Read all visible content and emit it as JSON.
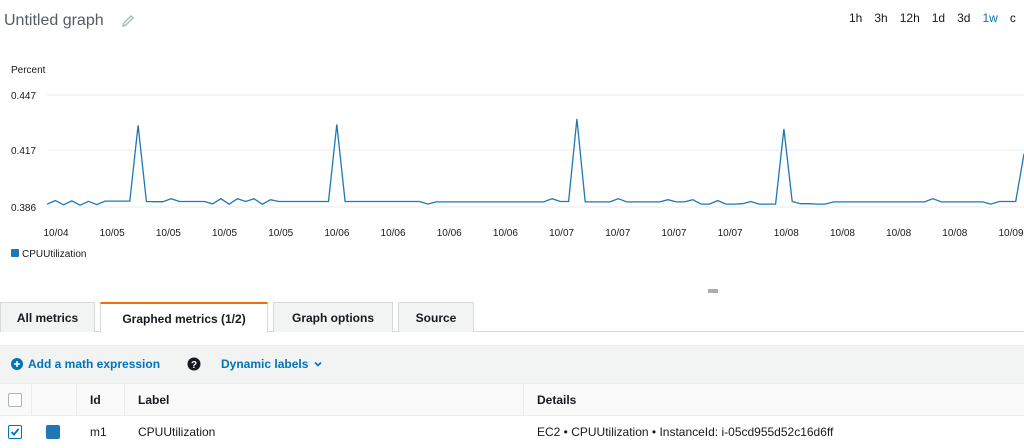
{
  "header": {
    "title": "Untitled graph",
    "edit_icon": "pencil-icon"
  },
  "time_range": {
    "options": [
      "1h",
      "3h",
      "12h",
      "1d",
      "3d",
      "1w",
      "c"
    ],
    "selected": "1w",
    "accent": "#0073bb"
  },
  "chart_data": {
    "type": "line",
    "ylabel": "Percent",
    "yticks": [
      "0.447",
      "0.417",
      "0.386"
    ],
    "ylim": [
      0.386,
      0.447
    ],
    "xticks": [
      "10/04",
      "10/05",
      "10/05",
      "10/05",
      "10/05",
      "10/06",
      "10/06",
      "10/06",
      "10/06",
      "10/07",
      "10/07",
      "10/07",
      "10/07",
      "10/08",
      "10/08",
      "10/08",
      "10/08",
      "10/09"
    ],
    "grid": true,
    "legend_position": "bottom-left",
    "series": [
      {
        "name": "CPUUtilization",
        "color": "#1f77b4",
        "values": [
          0.3875,
          0.3895,
          0.3872,
          0.3893,
          0.387,
          0.3891,
          0.3873,
          0.3892,
          0.3892,
          0.3892,
          0.3892,
          0.4305,
          0.389,
          0.3889,
          0.3889,
          0.3905,
          0.389,
          0.389,
          0.389,
          0.389,
          0.3877,
          0.3905,
          0.3875,
          0.3905,
          0.389,
          0.3905,
          0.3875,
          0.39,
          0.389,
          0.389,
          0.389,
          0.389,
          0.389,
          0.389,
          0.389,
          0.431,
          0.389,
          0.389,
          0.389,
          0.389,
          0.389,
          0.389,
          0.389,
          0.389,
          0.389,
          0.389,
          0.3876,
          0.3888,
          0.3888,
          0.3888,
          0.3888,
          0.3888,
          0.3888,
          0.3888,
          0.3888,
          0.3888,
          0.3888,
          0.3888,
          0.3888,
          0.3888,
          0.3888,
          0.3905,
          0.389,
          0.389,
          0.434,
          0.3888,
          0.3888,
          0.3888,
          0.3888,
          0.3905,
          0.3888,
          0.3888,
          0.3888,
          0.3888,
          0.3888,
          0.39,
          0.3888,
          0.3888,
          0.39,
          0.3876,
          0.3876,
          0.3895,
          0.3876,
          0.3876,
          0.3878,
          0.389,
          0.3876,
          0.3876,
          0.3876,
          0.4285,
          0.389,
          0.3878,
          0.3878,
          0.3876,
          0.3876,
          0.3888,
          0.3888,
          0.3888,
          0.3888,
          0.3888,
          0.3888,
          0.3888,
          0.3888,
          0.3888,
          0.3888,
          0.3888,
          0.3888,
          0.3905,
          0.3888,
          0.3888,
          0.3888,
          0.3888,
          0.3888,
          0.3888,
          0.3876,
          0.389,
          0.389,
          0.389,
          0.415
        ]
      }
    ]
  },
  "tabs": [
    {
      "label": "All metrics",
      "active": false
    },
    {
      "label": "Graphed metrics (1/2)",
      "active": true
    },
    {
      "label": "Graph options",
      "active": false
    },
    {
      "label": "Source",
      "active": false
    }
  ],
  "toolbar": {
    "add_math": "Add a math expression",
    "add_icon": "plus-circle-icon",
    "help_icon": "help-icon",
    "dynamic_labels": "Dynamic labels",
    "dropdown_icon": "chevron-down-icon"
  },
  "table": {
    "columns": {
      "id": "Id",
      "label": "Label",
      "details": "Details"
    },
    "rows": [
      {
        "checked": true,
        "color": "#1f77b4",
        "id": "m1",
        "label": "CPUUtilization",
        "details": "EC2 • CPUUtilization • InstanceId: i-05cd955d52c16d6ff"
      }
    ]
  }
}
